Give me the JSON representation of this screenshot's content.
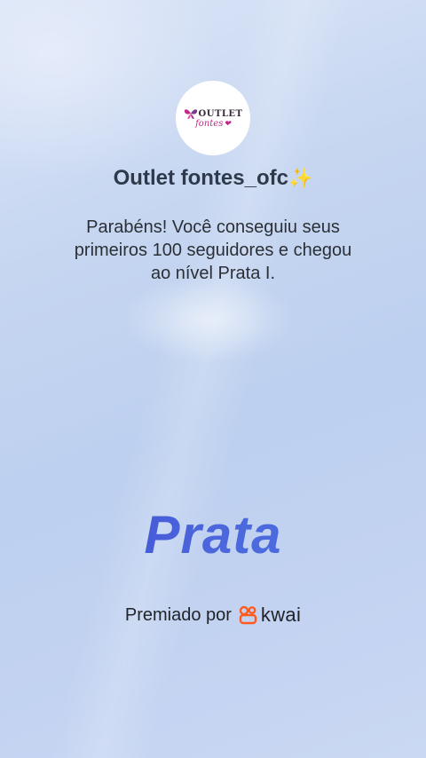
{
  "profile": {
    "logo": {
      "line1": "OUTLET",
      "line2": "fontes",
      "icon": "butterfly-icon"
    },
    "name": "Outlet fontes_ofc",
    "name_emoji": "✨"
  },
  "message": {
    "line1": "Parabéns! Você conseguiu seus",
    "line2": "primeiros 100 seguidores e chegou",
    "line3": "ao nível Prata I."
  },
  "rank": {
    "label": "Prata"
  },
  "awarded_by": {
    "label": "Premiado por",
    "brand": "kwai",
    "brand_icon": "kwai-logo-icon",
    "brand_color": "#ff5a1f"
  },
  "colors": {
    "rank_gradient_start": "#3a48cf",
    "rank_gradient_end": "#4a74e2",
    "background": "#c6d6f1"
  }
}
